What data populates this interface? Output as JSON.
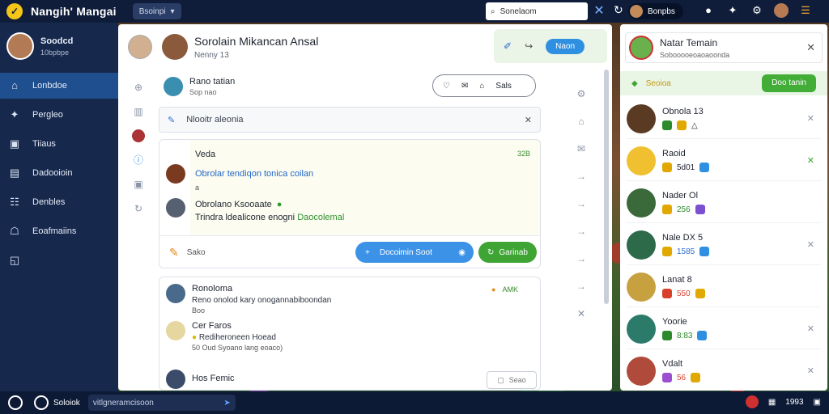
{
  "topbar": {
    "app_title": "Nangih' Mangai",
    "workspace": "Bsoinpi",
    "search_value": "Sonelaom",
    "user_name": "Bonpbs"
  },
  "sidebar": {
    "profile_name": "Soodcd",
    "profile_sub": "10bpbpe",
    "items": [
      {
        "label": "Lonbdoe",
        "icon": "home-icon"
      },
      {
        "label": "Pergleo",
        "icon": "puzzle-icon"
      },
      {
        "label": "Tiiaus",
        "icon": "game-icon"
      },
      {
        "label": "Dadooioin",
        "icon": "board-icon"
      },
      {
        "label": "Denbles",
        "icon": "list-icon"
      },
      {
        "label": "Eoafmaiins",
        "icon": "shop-icon"
      },
      {
        "label": "",
        "icon": "chat-icon"
      }
    ]
  },
  "conversation": {
    "title": "Sorolain Mikancan Ansal",
    "subtitle": "Nenny 13",
    "join_label": "Naon",
    "post_author": "Rano tatian",
    "post_meta": "Sop nao",
    "pill_action_label": "Sals",
    "note_placeholder": "Nlooitr aleonia",
    "thread_label": "Veda",
    "thread_count": "32B",
    "msg1_text": "Obrolar tendiqon tonica coilan",
    "msg1_meta": "a",
    "msg2_name": "Obrolano Ksooaate",
    "msg2_text_a": "Trindra ldealicone enogni",
    "msg2_text_b": "Daocolemal",
    "foot_label": "Sako",
    "blue_button": "Docoimin Soot",
    "green_button": "Garinab",
    "card2_author": "Ronoloma",
    "card2_text": "Reno onolod kary onogannabiboondan",
    "card2_meta": "Boo",
    "card2_count": "AMK",
    "card2_second_author": "Cer Faros",
    "card2_second_text": "Rediheroneen Hoead",
    "card2_second_meta": "50 Oud Syoano lang eoaco)",
    "card2_third_author": "Hos Femic",
    "save_label": "Seao"
  },
  "right_panel": {
    "title": "Natar Temain",
    "subtitle": "Sobooooeoaoaoonda",
    "bar_label": "Seoioa",
    "bar_button": "Doo tanin",
    "friends": [
      {
        "name": "Obnola 13",
        "val": "",
        "color": "#2c8a2c"
      },
      {
        "name": "Raoid",
        "val": "5d01",
        "color": "#e0a800"
      },
      {
        "name": "Nader Ol",
        "val": "256",
        "color": "#2c8a2c"
      },
      {
        "name": "Nale DX 5",
        "val": "1585",
        "color": "#2c8a2c"
      },
      {
        "name": "Lanat 8",
        "val": "550",
        "color": "#d9402c"
      },
      {
        "name": "Yoorie",
        "val": "8:83",
        "color": "#2c8a2c"
      },
      {
        "name": "Vdalt",
        "val": "56",
        "color": "#9b4fd0"
      }
    ]
  },
  "bottombar": {
    "label": "Soloiok",
    "input_value": "vitlgneramcisoon",
    "count": "1993"
  }
}
